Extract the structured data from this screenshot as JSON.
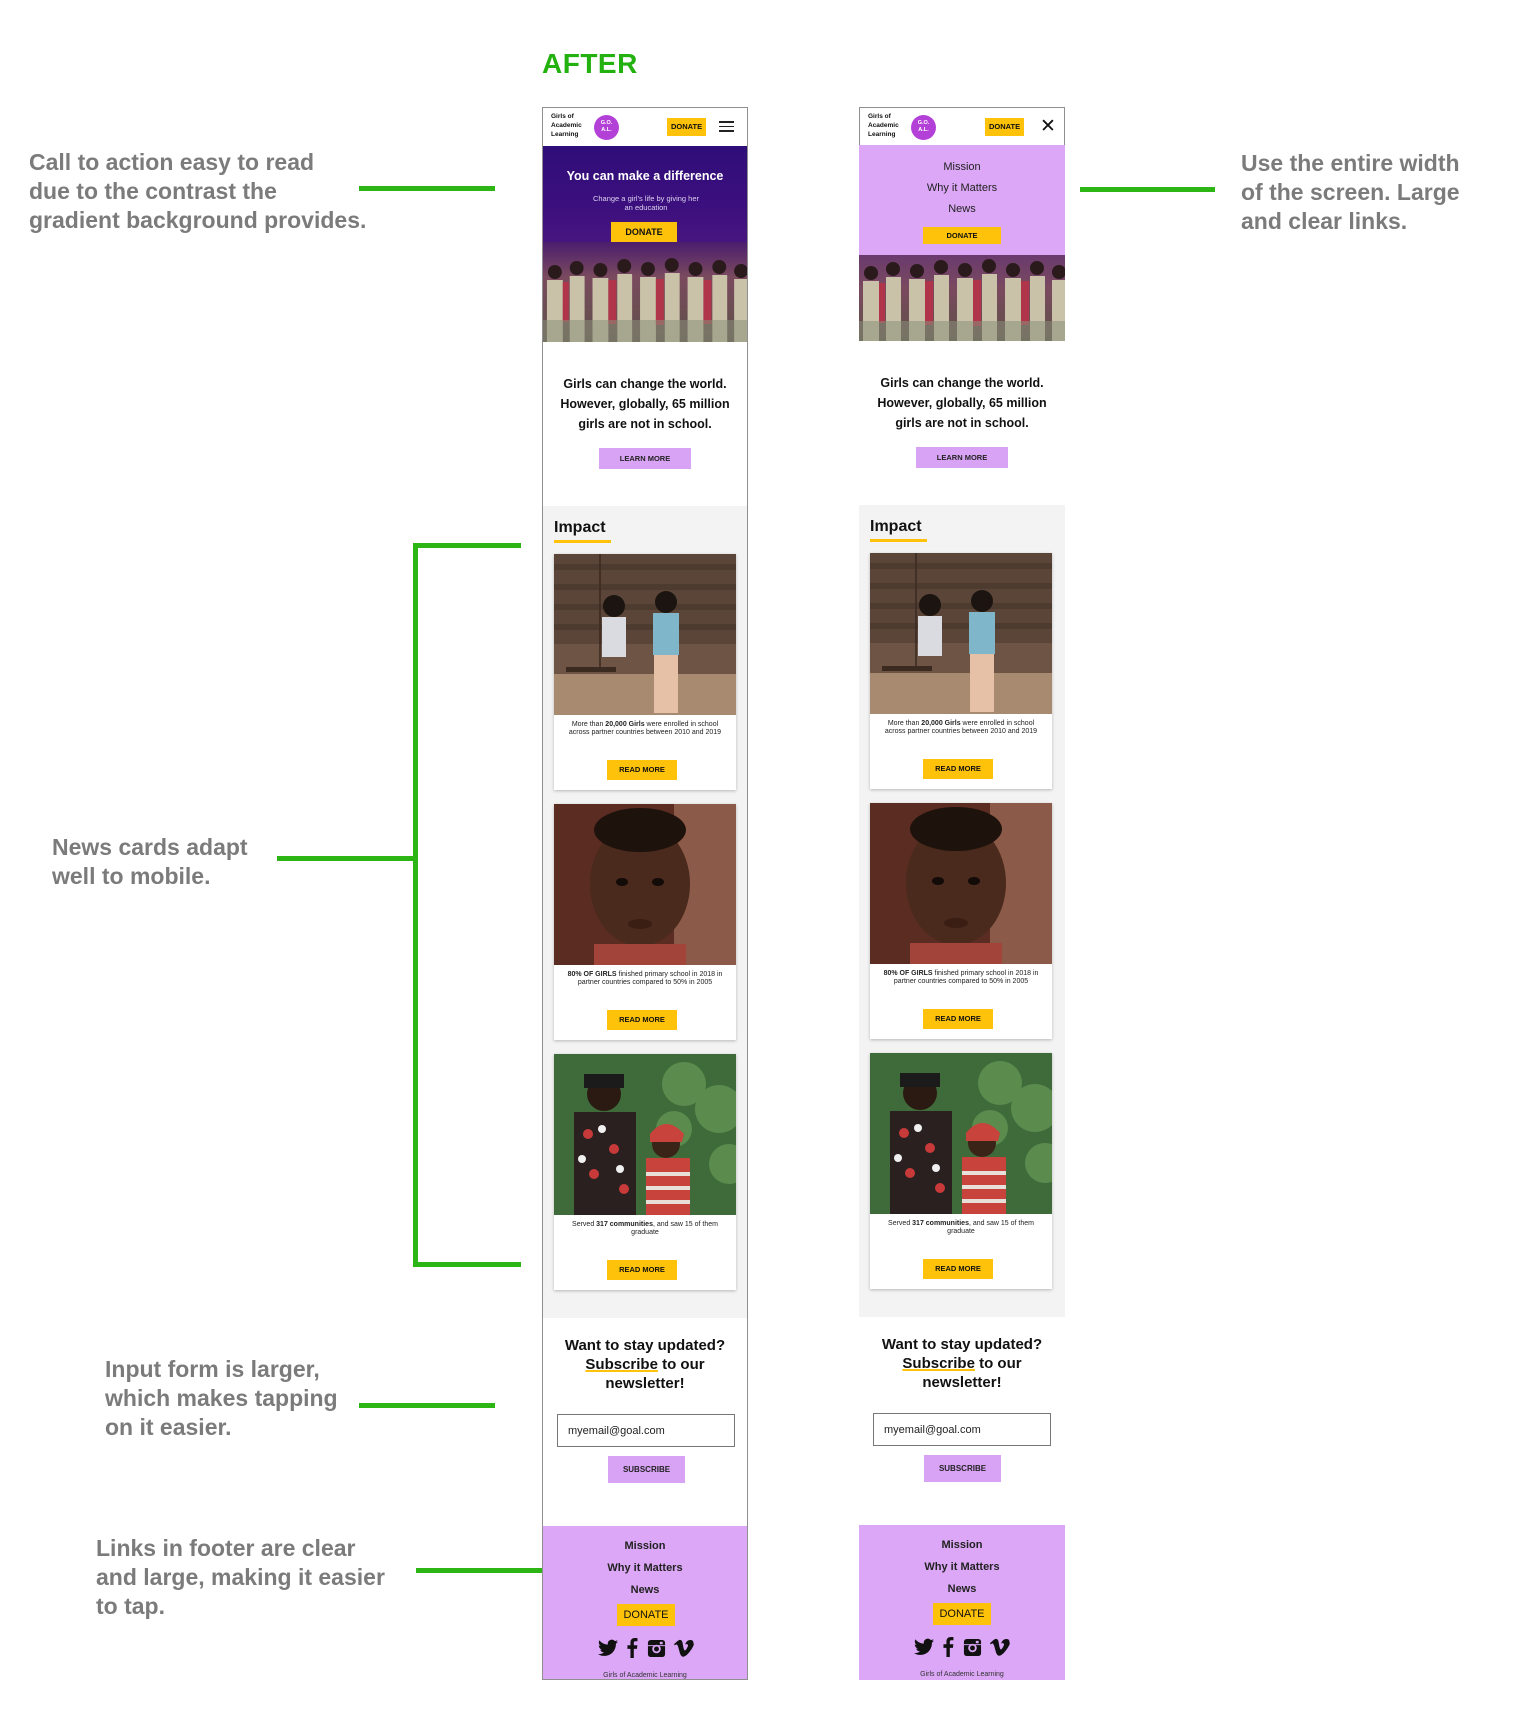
{
  "heading": "AFTER",
  "annotations": [
    "Call to action easy to read\ndue to the contrast the\ngradient background provides.",
    "Use the entire width\nof the screen. Large\nand clear links.",
    "News cards adapt\nwell to mobile.",
    "Input form is larger,\nwhich makes tapping\non it easier.",
    "Links in footer are clear\nand large, making it easier\nto tap."
  ],
  "logo": {
    "text": "Girls of\nAcademic\nLearning",
    "badge": "G.O.\nA.L."
  },
  "header": {
    "donate": "DONATE"
  },
  "hero": {
    "title": "You can make a difference",
    "subtitle": "Change a girl's life by giving her an education",
    "donate": "DONATE"
  },
  "menu": {
    "items": [
      "Mission",
      "Why it Matters",
      "News"
    ],
    "donate": "DONATE"
  },
  "mission": {
    "line1": "Girls can change the world.",
    "line2": "However, globally, 65 million",
    "line3": "girls are not in school.",
    "cta": "LEARN MORE"
  },
  "impact": {
    "title": "Impact",
    "cards": [
      {
        "pre": "More than ",
        "bold": "20,000 Girls",
        "post": " were enrolled in school across partner countries between 2010 and 2019",
        "button": "READ MORE"
      },
      {
        "pre": "",
        "bold": "80% OF GIRLS",
        "post": " finished primary school in 2018 in partner countries compared to 50% in 2005",
        "button": "READ MORE"
      },
      {
        "pre": "Served ",
        "bold": "317 communities",
        "post": ", and saw 15 of them graduate",
        "button": "READ MORE"
      }
    ]
  },
  "newsletter": {
    "line1": "Want to stay updated?",
    "subscribe": "Subscribe",
    "line2_rest": " to our",
    "line3": "newsletter!",
    "email_value": "myemail@goal.com",
    "button": "SUBSCRIBE"
  },
  "footer": {
    "links": [
      "Mission",
      "Why it Matters",
      "News"
    ],
    "donate": "DONATE",
    "social_icons": [
      "twitter-icon",
      "facebook-icon",
      "instagram-icon",
      "vimeo-icon"
    ],
    "copyright": "Girls of Academic Learning"
  },
  "colors": {
    "accent_yellow": "#ffc20a",
    "lavender": "#dba7f6",
    "hero_purple": "#2f0e79",
    "annotation_green": "#2cb514",
    "annotation_gray": "#7b7b7b"
  }
}
